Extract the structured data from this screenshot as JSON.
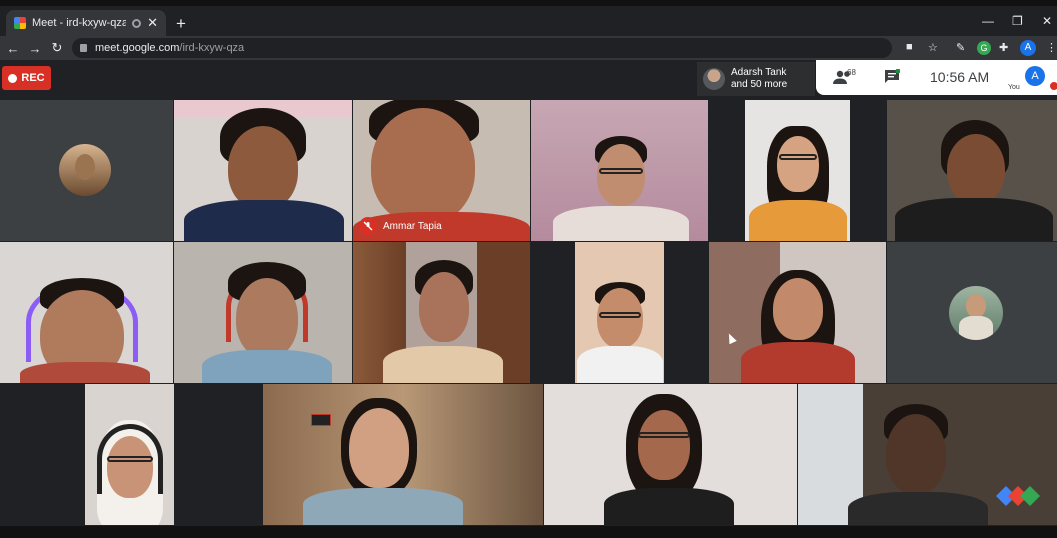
{
  "browser": {
    "tab_title": "Meet - ird-kxyw-qza",
    "url_host": "meet.google.com",
    "url_path": "/ird-kxyw-qza",
    "profile_initial": "A",
    "extension_initial": "G"
  },
  "meet": {
    "recording_label": "REC",
    "presenter": {
      "name": "Adarsh Tank",
      "more": "and 50 more"
    },
    "participant_count": "68",
    "time": "10:56 AM",
    "self_initial": "A",
    "self_label": "You",
    "tiles": [
      {
        "type": "avatar"
      },
      {
        "type": "video"
      },
      {
        "type": "video",
        "name": "Ammar Tapia",
        "muted": true
      },
      {
        "type": "video"
      },
      {
        "type": "video"
      },
      {
        "type": "video"
      },
      {
        "type": "video"
      },
      {
        "type": "video"
      },
      {
        "type": "video"
      },
      {
        "type": "video"
      },
      {
        "type": "video"
      },
      {
        "type": "avatar"
      },
      {
        "type": "video"
      },
      {
        "type": "video"
      },
      {
        "type": "video"
      },
      {
        "type": "video"
      }
    ]
  },
  "colors": {
    "rec": "#d93025",
    "meet_bg": "#202124",
    "accent": "#1a73e8"
  }
}
